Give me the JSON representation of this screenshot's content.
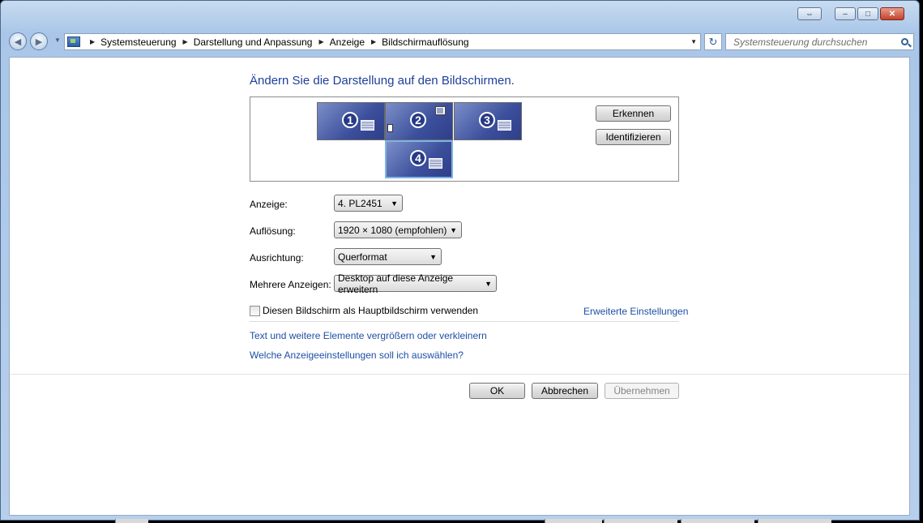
{
  "window": {
    "caption_extra": "⇔",
    "caption_minimize": "–",
    "caption_maximize": "□",
    "caption_close": "✕"
  },
  "address_bar": {
    "back": "◀",
    "forward": "▶",
    "breadcrumbs": [
      "Systemsteuerung",
      "Darstellung und Anpassung",
      "Anzeige",
      "Bildschirmauflösung"
    ],
    "refresh": "↻",
    "search_placeholder": "Systemsteuerung durchsuchen"
  },
  "page": {
    "title": "Ändern Sie die Darstellung auf den Bildschirmen.",
    "monitors": [
      "1",
      "2",
      "3",
      "4"
    ],
    "detect_button": "Erkennen",
    "identify_button": "Identifizieren",
    "display_label": "Anzeige:",
    "display_value": "4. PL2451",
    "resolution_label": "Auflösung:",
    "resolution_value": "1920 × 1080 (empfohlen)",
    "orientation_label": "Ausrichtung:",
    "orientation_value": "Querformat",
    "multiple_label": "Mehrere Anzeigen:",
    "multiple_value": "Desktop auf diese Anzeige erweitern",
    "primary_checkbox_label": "Diesen Bildschirm als Hauptbildschirm verwenden",
    "primary_checked": false,
    "advanced_link": "Erweiterte Einstellungen",
    "text_size_link": "Text und weitere Elemente vergrößern oder verkleinern",
    "which_settings_link": "Welche Anzeigeeinstellungen soll ich auswählen?",
    "ok_button": "OK",
    "cancel_button": "Abbrechen",
    "apply_button": "Übernehmen"
  }
}
